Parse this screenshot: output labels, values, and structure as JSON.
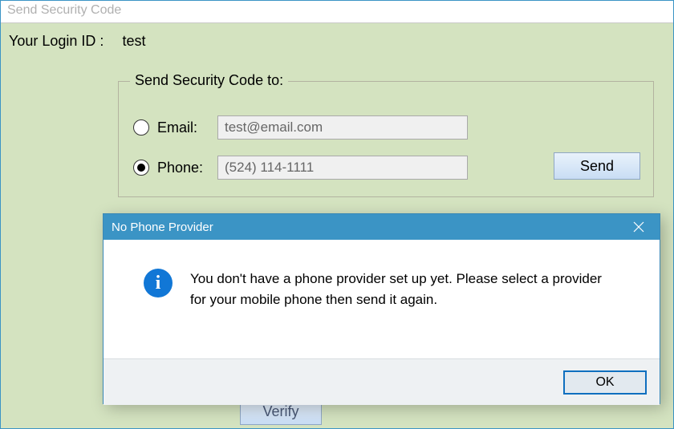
{
  "window": {
    "title": "Send Security Code"
  },
  "login": {
    "label": "Your Login ID :",
    "value": "test"
  },
  "group": {
    "legend": "Send Security Code to:",
    "email_label": "Email:",
    "email_value": "test@email.com",
    "phone_label": "Phone:",
    "phone_value": "(524) 114-1111",
    "selected": "phone",
    "send_label": "Send"
  },
  "hidden_button": {
    "label": "Verify"
  },
  "dialog": {
    "title": "No Phone Provider",
    "message": "You don't have a phone provider set up yet. Please select a provider for your mobile phone then send it again.",
    "ok_label": "OK"
  }
}
